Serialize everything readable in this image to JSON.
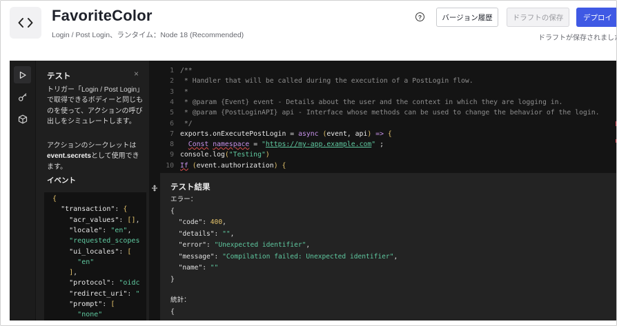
{
  "header": {
    "title": "FavoriteColor",
    "subtitle": "Login / Post Login、ランタイム：Node 18 (Recommended)",
    "help_label": "?",
    "version_history_label": "バージョン履歴",
    "save_draft_label": "ドラフトの保存",
    "deploy_label": "デプロイ",
    "draft_status": "ドラフトが保存されました"
  },
  "test_panel": {
    "title": "テスト",
    "close_label": "×",
    "description": "トリガー「Login / Post Login」で取得できるボディーと同じものを使って、アクションの呼び出しをシミュレートします。",
    "secrets_prefix": "アクションのシークレットは",
    "secrets_code": "event.secrets",
    "secrets_suffix": "として使用できます。",
    "events_label": "イベント",
    "event_json": [
      "  {",
      "    \"transaction\": {",
      "      \"acr_values\": [],",
      "      \"locale\": \"en\",",
      "      \"requested_scopes",
      "      \"ui_locales\": [",
      "        \"en\"",
      "      ],",
      "      \"protocol\": \"oidc",
      "      \"redirect_uri\": \"",
      "      \"prompt\": [",
      "        \"none\""
    ]
  },
  "editor": {
    "line_numbers": [
      "1",
      "2",
      "3",
      "4",
      "5",
      "6",
      "7",
      "8",
      "9",
      "10"
    ],
    "lines": [
      "/**",
      " * Handler that will be called during the execution of a PostLogin flow.",
      " *",
      " * @param {Event} event - Details about the user and the context in which they are logging in.",
      " * @param {PostLoginAPI} api - Interface whose methods can be used to change the behavior of the login.",
      " */",
      "exports.onExecutePostLogin = async (event, api) => {",
      "  Const namespace = \"https://my-app.example.com\" ;",
      "console.log(\"Testing\")",
      "If (event.authorization) {"
    ]
  },
  "results": {
    "title": "テスト結果",
    "error_label": "エラー：",
    "open_brace": "{",
    "close_brace": "}",
    "fields": [
      {
        "key": "\"code\"",
        "value": "400"
      },
      {
        "key": "\"details\"",
        "value": "\"\""
      },
      {
        "key": "\"error\"",
        "value": "\"Unexpected identifier\""
      },
      {
        "key": "\"message\"",
        "value": "\"Compilation failed: Unexpected identifier\""
      },
      {
        "key": "\"name\"",
        "value": "\"\""
      }
    ],
    "stats_label": "統計：",
    "stats_open": "{"
  },
  "colors": {
    "deploy_button": "#3f59e4",
    "editor_background": "#141414",
    "results_background": "#232323",
    "string": "#5fc9a0",
    "number": "#e6c46b",
    "keyword": "#c792ea"
  },
  "icons": {
    "app": "code-brackets-icon",
    "rail": [
      "play-icon",
      "key-icon",
      "cube-icon"
    ],
    "resize": "drag-handle-icon"
  }
}
